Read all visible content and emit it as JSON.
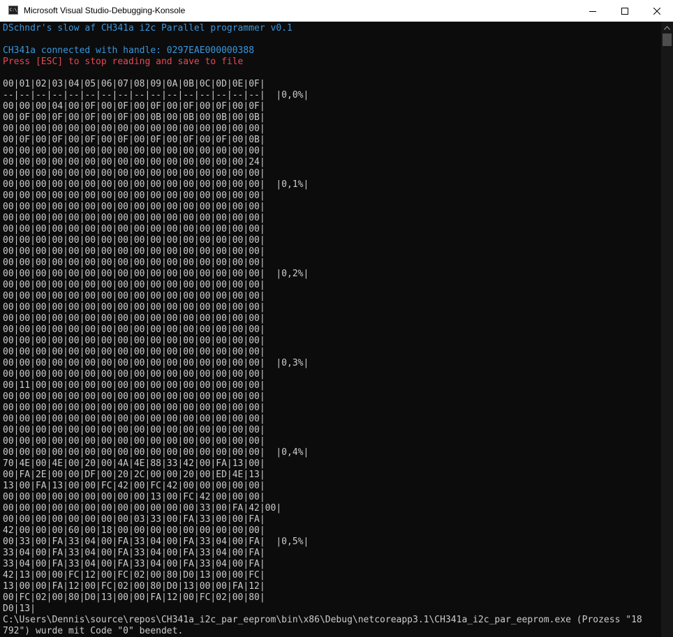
{
  "window": {
    "title": "Microsoft Visual Studio-Debugging-Konsole",
    "app_icon_text": "C:\\",
    "icons": [
      "minimize-icon",
      "maximize-icon",
      "close-icon",
      "chevron-up-icon"
    ]
  },
  "colors": {
    "background": "#0c0c0c",
    "text": "#cccccc",
    "cyan": "#3a96dd",
    "red": "#e74856",
    "titlebar": "#ffffff"
  },
  "console": {
    "lines": [
      {
        "text": "DSchndr's slow af CH341a i2c Parallel programmer v0.1",
        "color": "cyan"
      },
      {
        "text": "",
        "color": ""
      },
      {
        "text": "CH341a connected with handle: 0297EAE000000388",
        "color": "cyan"
      },
      {
        "text": "Press [ESC] to stop reading and save to file",
        "color": "red"
      },
      {
        "text": "",
        "color": ""
      },
      {
        "text": "00|01|02|03|04|05|06|07|08|09|0A|0B|0C|0D|0E|0F|",
        "color": ""
      },
      {
        "text": "--|--|--|--|--|--|--|--|--|--|--|--|--|--|--|--|  |0,0%|",
        "color": ""
      },
      {
        "text": "00|00|00|04|00|0F|00|0F|00|0F|00|0F|00|0F|00|0F|",
        "color": ""
      },
      {
        "text": "00|0F|00|0F|00|0F|00|0F|00|0B|00|0B|00|0B|00|0B|",
        "color": ""
      },
      {
        "text": "00|00|00|00|00|00|00|00|00|00|00|00|00|00|00|00|",
        "color": ""
      },
      {
        "text": "00|0F|00|0F|00|0F|00|0F|00|0F|00|0F|00|0F|00|0B|",
        "color": ""
      },
      {
        "text": "00|00|00|00|00|00|00|00|00|00|00|00|00|00|00|00|",
        "color": ""
      },
      {
        "text": "00|00|00|00|00|00|00|00|00|00|00|00|00|00|00|24|",
        "color": ""
      },
      {
        "text": "00|00|00|00|00|00|00|00|00|00|00|00|00|00|00|00|",
        "color": ""
      },
      {
        "text": "00|00|00|00|00|00|00|00|00|00|00|00|00|00|00|00|  |0,1%|",
        "color": ""
      },
      {
        "text": "00|00|00|00|00|00|00|00|00|00|00|00|00|00|00|00|",
        "color": ""
      },
      {
        "text": "00|00|00|00|00|00|00|00|00|00|00|00|00|00|00|00|",
        "color": ""
      },
      {
        "text": "00|00|00|00|00|00|00|00|00|00|00|00|00|00|00|00|",
        "color": ""
      },
      {
        "text": "00|00|00|00|00|00|00|00|00|00|00|00|00|00|00|00|",
        "color": ""
      },
      {
        "text": "00|00|00|00|00|00|00|00|00|00|00|00|00|00|00|00|",
        "color": ""
      },
      {
        "text": "00|00|00|00|00|00|00|00|00|00|00|00|00|00|00|00|",
        "color": ""
      },
      {
        "text": "00|00|00|00|00|00|00|00|00|00|00|00|00|00|00|00|",
        "color": ""
      },
      {
        "text": "00|00|00|00|00|00|00|00|00|00|00|00|00|00|00|00|  |0,2%|",
        "color": ""
      },
      {
        "text": "00|00|00|00|00|00|00|00|00|00|00|00|00|00|00|00|",
        "color": ""
      },
      {
        "text": "00|00|00|00|00|00|00|00|00|00|00|00|00|00|00|00|",
        "color": ""
      },
      {
        "text": "00|00|00|00|00|00|00|00|00|00|00|00|00|00|00|00|",
        "color": ""
      },
      {
        "text": "00|00|00|00|00|00|00|00|00|00|00|00|00|00|00|00|",
        "color": ""
      },
      {
        "text": "00|00|00|00|00|00|00|00|00|00|00|00|00|00|00|00|",
        "color": ""
      },
      {
        "text": "00|00|00|00|00|00|00|00|00|00|00|00|00|00|00|00|",
        "color": ""
      },
      {
        "text": "00|00|00|00|00|00|00|00|00|00|00|00|00|00|00|00|",
        "color": ""
      },
      {
        "text": "00|00|00|00|00|00|00|00|00|00|00|00|00|00|00|00|  |0,3%|",
        "color": ""
      },
      {
        "text": "00|00|00|00|00|00|00|00|00|00|00|00|00|00|00|00|",
        "color": ""
      },
      {
        "text": "00|11|00|00|00|00|00|00|00|00|00|00|00|00|00|00|",
        "color": ""
      },
      {
        "text": "00|00|00|00|00|00|00|00|00|00|00|00|00|00|00|00|",
        "color": ""
      },
      {
        "text": "00|00|00|00|00|00|00|00|00|00|00|00|00|00|00|00|",
        "color": ""
      },
      {
        "text": "00|00|00|00|00|00|00|00|00|00|00|00|00|00|00|00|",
        "color": ""
      },
      {
        "text": "00|00|00|00|00|00|00|00|00|00|00|00|00|00|00|00|",
        "color": ""
      },
      {
        "text": "00|00|00|00|00|00|00|00|00|00|00|00|00|00|00|00|",
        "color": ""
      },
      {
        "text": "00|00|00|00|00|00|00|00|00|00|00|00|00|00|00|00|  |0,4%|",
        "color": ""
      },
      {
        "text": "70|4E|00|4E|00|20|00|4A|4E|88|33|42|00|FA|13|00|",
        "color": ""
      },
      {
        "text": "00|FA|2E|00|00|DF|00|20|2C|00|00|20|00|ED|4E|13|",
        "color": ""
      },
      {
        "text": "13|00|FA|13|00|00|FC|42|00|FC|42|00|00|00|00|00|",
        "color": ""
      },
      {
        "text": "00|00|00|00|00|00|00|00|00|13|00|FC|42|00|00|00|",
        "color": ""
      },
      {
        "text": "00|00|00|00|00|00|00|00|00|00|00|00|33|00|FA|42|00|",
        "color": ""
      },
      {
        "text": "00|00|00|00|00|00|00|00|03|33|00|FA|33|00|00|FA|",
        "color": ""
      },
      {
        "text": "42|00|00|00|60|00|18|00|00|00|00|00|00|00|00|00|",
        "color": ""
      },
      {
        "text": "00|33|00|FA|33|04|00|FA|33|04|00|FA|33|04|00|FA|  |0,5%|",
        "color": ""
      },
      {
        "text": "33|04|00|FA|33|04|00|FA|33|04|00|FA|33|04|00|FA|",
        "color": ""
      },
      {
        "text": "33|04|00|FA|33|04|00|FA|33|04|00|FA|33|04|00|FA|",
        "color": ""
      },
      {
        "text": "42|13|00|00|FC|12|00|FC|02|00|80|D0|13|00|00|FC|",
        "color": ""
      },
      {
        "text": "13|00|00|FA|12|00|FC|02|00|80|D0|13|00|00|FA|12|",
        "color": ""
      },
      {
        "text": "00|FC|02|00|80|D0|13|00|00|FA|12|00|FC|02|00|80|",
        "color": ""
      },
      {
        "text": "D0|13|",
        "color": ""
      },
      {
        "text": "C:\\Users\\Dennis\\source\\repos\\CH341a_i2c_par_eeprom\\bin\\x86\\Debug\\netcoreapp3.1\\CH341a_i2c_par_eeprom.exe (Prozess \"18",
        "color": ""
      },
      {
        "text": "792\") wurde mit Code \"0\" beendet.",
        "color": ""
      }
    ]
  }
}
